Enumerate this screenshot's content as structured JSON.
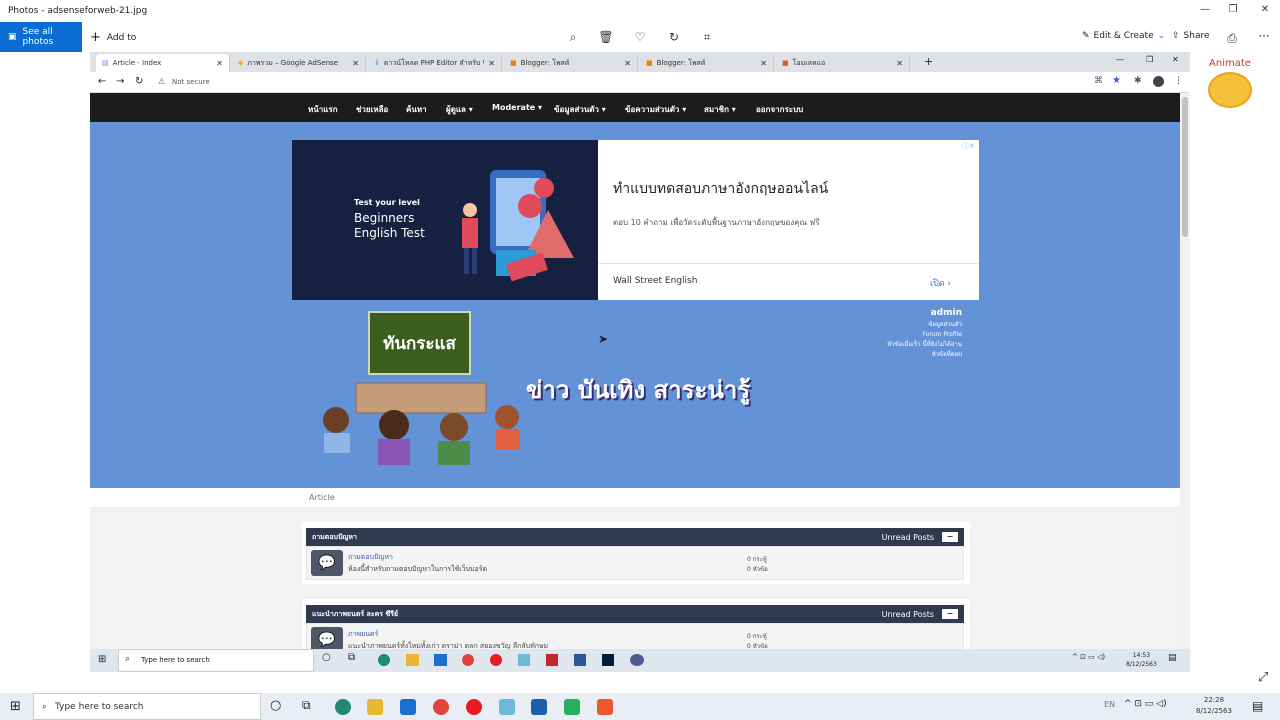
{
  "photos_app": {
    "title": "Photos - adsenseforweb-21.jpg",
    "see_all": "See all photos",
    "add_to": "Add to",
    "edit_create": "Edit & Create",
    "share": "Share",
    "more": "···"
  },
  "browser": {
    "tabs": [
      {
        "label": "Article - Index",
        "active": true
      },
      {
        "label": "ภาพรวม – Google AdSense",
        "active": false
      },
      {
        "label": "ดาวน์โหลด PHP Editor สำหรับ Wind",
        "active": false
      },
      {
        "label": "Blogger: โพสต์",
        "active": false
      },
      {
        "label": "Blogger: โพสต์",
        "active": false
      },
      {
        "label": "โอมเลทแอ",
        "active": false
      }
    ],
    "address": "Not secure",
    "nav": [
      "หน้าแรก",
      "ช่วยเหลือ",
      "ค้นหา",
      "ผู้ดูแล ▾",
      "Moderate ▾",
      "ข้อมูลส่วนตัว ▾",
      "ข้อความส่วนตัว ▾",
      "สมาชิก ▾",
      "ออกจากระบบ"
    ],
    "ad": {
      "img_line1": "Test your level",
      "img_line2": "Beginners",
      "img_line3": "English Test",
      "headline": "ทำแบบทดสอบภาษาอังกฤษออนไลน์",
      "body": "ตอบ 10 คำถาม เพื่อวัดระดับพื้นฐานภาษาอังกฤษของคุณ ฟรี",
      "advertiser": "Wall Street English",
      "cta": "เปิด"
    },
    "logo_sign": "ทันกระแส",
    "banner_title": "ข่าว บันเทิง สาระน่ารู้",
    "user_menu": {
      "name": "admin",
      "links": [
        "ข้อมูลส่วนตัว",
        "Forum Profile",
        "หัวข้อเมื่อเร็ว นี้ที่ยังไม่ได้อ่าน",
        "หัวข้อที่ตอบ"
      ]
    },
    "breadcrumb": "Article",
    "forums": [
      {
        "category": "ถามตอบปัญหา",
        "unread": "Unread Posts",
        "board_title": "ถามตอบปัญหา",
        "board_desc": "ห้องนี้สำหรับถามตอบปัญหาในการใช้เว็บบอร์ด",
        "posts": "0 กระทู้",
        "topics": "0 หัวข้อ"
      },
      {
        "category": "แนะนำภาพยนตร์ ละคร ซีรีย์",
        "unread": "Unread Posts",
        "board_title": "ภาพยนตร์",
        "board_desc": "แนะนำภาพยนตร์ทั้งใหม่ทั้งเก่า ดราม่า ตลก สยองขวัญ ลึกลับทักษม",
        "posts": "0 กระทู้",
        "topics": "0 หัวข้อ"
      }
    ],
    "inner_taskbar": {
      "search": "Type here to search",
      "time": "14:53",
      "date": "8/12/2563"
    }
  },
  "right_panel": {
    "animate": "Animate"
  },
  "taskbar": {
    "search": "Type here to search",
    "time": "22:28",
    "date": "8/12/2563"
  },
  "colors": {
    "accent": "#0b6cd3",
    "nav_bg": "#1c1c1c",
    "banner_bg": "#6392d6",
    "forum_head": "#303a4e"
  }
}
